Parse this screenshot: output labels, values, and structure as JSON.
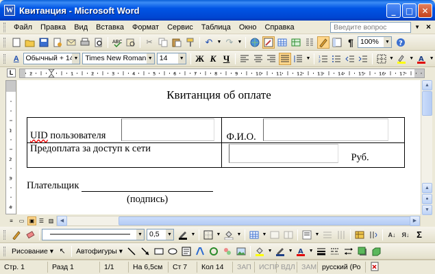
{
  "window": {
    "title": "Квитанция - Microsoft Word",
    "app_icon_letter": "W"
  },
  "window_buttons": {
    "minimize": "_",
    "maximize": "□",
    "close": "✕"
  },
  "menu": {
    "items": [
      "Файл",
      "Правка",
      "Вид",
      "Вставка",
      "Формат",
      "Сервис",
      "Таблица",
      "Окно",
      "Справка"
    ],
    "ask_placeholder": "Введите вопрос",
    "ask_arrow": "▼",
    "doc_close": "×"
  },
  "standard_toolbar": {
    "zoom": "100%",
    "pilcrow": "¶",
    "icons": [
      "new-icon",
      "open-icon",
      "save-icon",
      "permission-icon",
      "email-icon",
      "print-icon",
      "print-preview-icon",
      "spelling-icon",
      "research-icon",
      "cut-icon",
      "copy-icon",
      "paste-icon",
      "format-painter-icon",
      "undo-icon",
      "redo-icon",
      "hyperlink-icon",
      "tables-borders-icon",
      "insert-table-icon",
      "insert-excel-icon",
      "columns-icon",
      "drawing-icon",
      "document-map-icon",
      "show-hide-icon",
      "help-icon"
    ]
  },
  "formatting_toolbar": {
    "style": "Обычный + 14 г",
    "font": "Times New Roman",
    "size": "14",
    "bold": "Ж",
    "italic": "К",
    "underline": "Ч"
  },
  "drawing_toolbar": {
    "line_weight": "0,5",
    "drawing_menu": "Рисование",
    "autoshapes_menu": "Автофигуры"
  },
  "document": {
    "heading": "Квитанция об оплате",
    "table": {
      "uid_label": "UID",
      "uid_label_rest": " пользователя",
      "fio_label": "Ф.И.О.",
      "prepay_label": "Предоплата за доступ к сети",
      "currency": "Руб."
    },
    "payer_label": "Плательщик",
    "signature_hint": "(подпись)"
  },
  "ruler": {
    "numbers": [
      "1",
      "2",
      "1",
      "2",
      "3",
      "4",
      "5",
      "6",
      "7",
      "8",
      "9",
      "10",
      "11",
      "12",
      "13",
      "14",
      "15",
      "16",
      "17"
    ]
  },
  "statusbar": {
    "page": "Стр.  1",
    "section": "Разд 1",
    "pages": "1/1",
    "at": "На 6,5см",
    "line": "Ст  7",
    "col": "Кол 14",
    "rec": "ЗАП",
    "trk": "ИСПР",
    "ext": "ВДЛ",
    "ovr": "ЗАМ",
    "lang": "русский (Ро"
  },
  "colors": {
    "title_bar": "#0055E5",
    "active_button": "#FFD689",
    "spell_error": "#E00000"
  }
}
